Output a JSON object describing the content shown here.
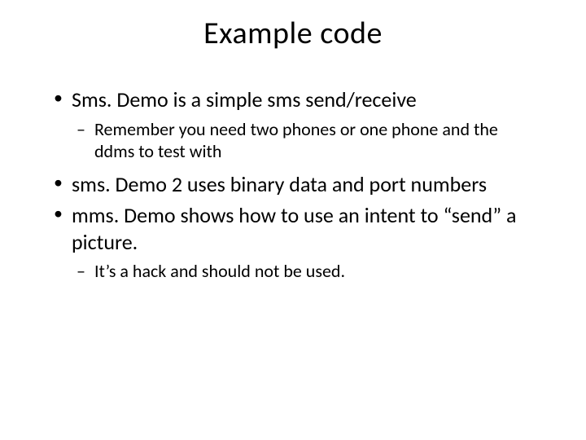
{
  "slide": {
    "title": "Example code",
    "bullets": [
      {
        "text": "Sms. Demo is a simple sms send/receive",
        "children": [
          {
            "text": "Remember you need two phones or one phone and the ddms to test with"
          }
        ]
      },
      {
        "text": "sms. Demo 2 uses binary data and port numbers",
        "children": []
      },
      {
        "text": "mms. Demo shows how to use an intent to “send” a picture.",
        "children": [
          {
            "text": "It’s a hack and should not be used."
          }
        ]
      }
    ]
  }
}
